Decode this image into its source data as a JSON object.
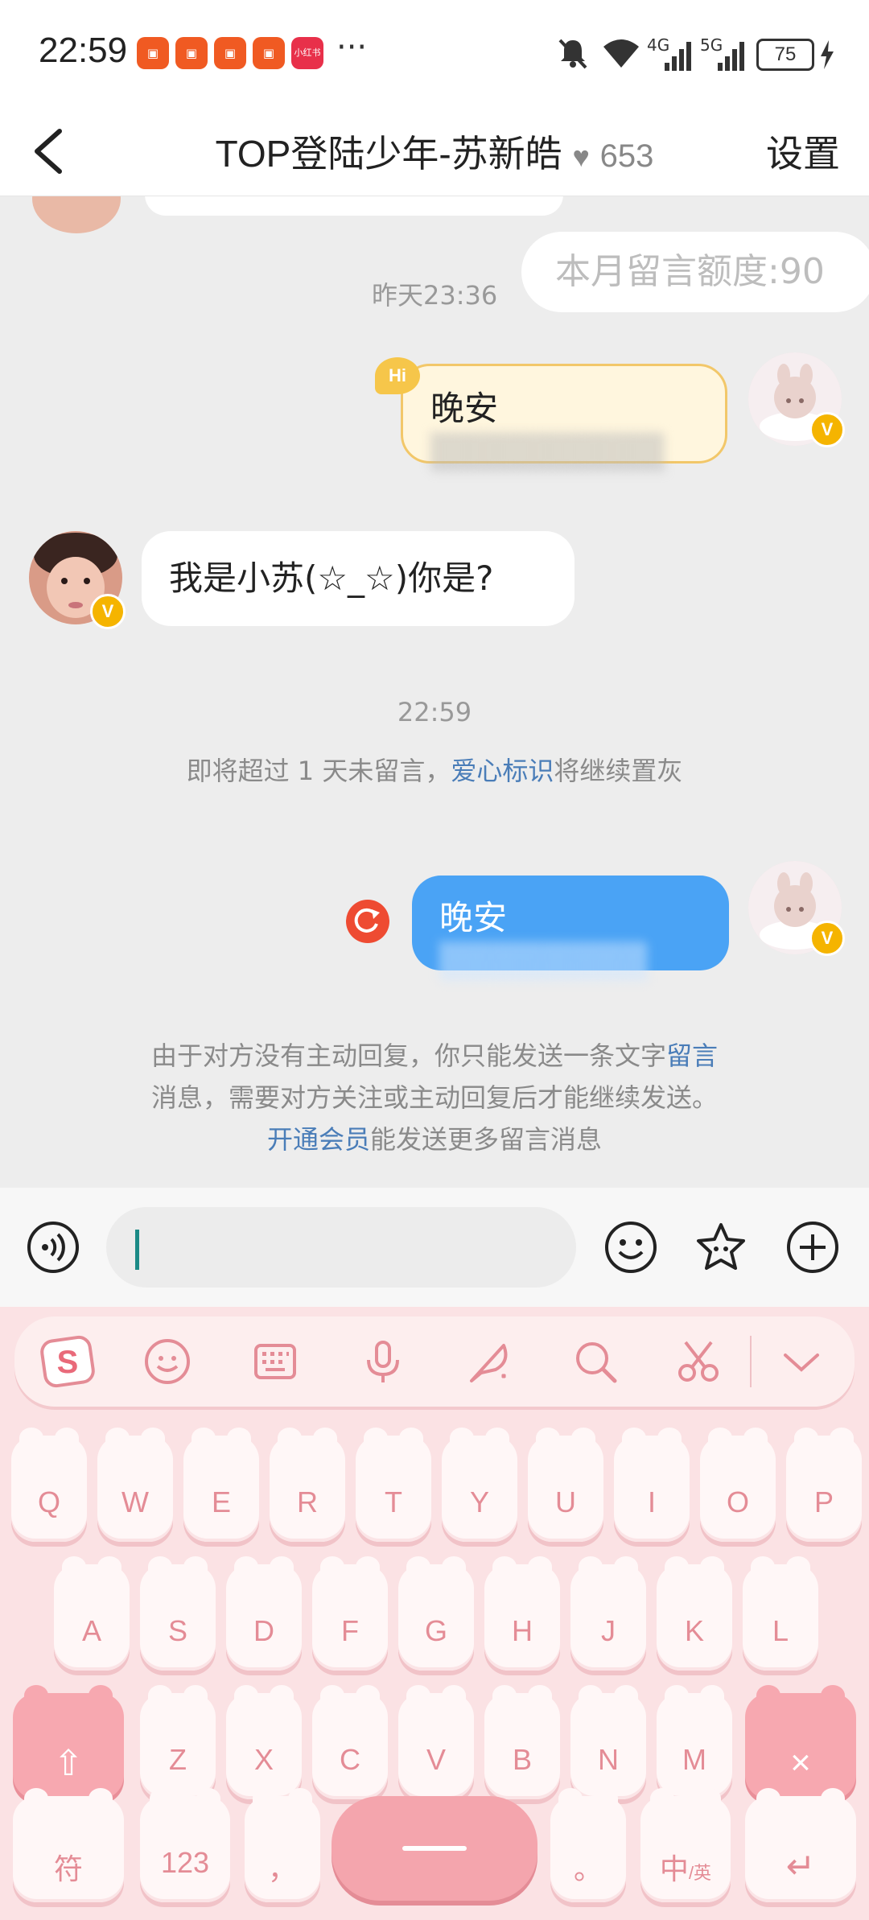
{
  "status_bar": {
    "time": "22:59",
    "app_icons": [
      "快手极速版",
      "快手",
      "快手极速版",
      "快手",
      "小红书"
    ],
    "more": "···",
    "network_4g": "4G",
    "network_5g": "5G",
    "battery": "75"
  },
  "header": {
    "title": "TOP登陆少年-苏新皓",
    "heart": "♥",
    "heart_count": "653",
    "settings_label": "设置"
  },
  "chat": {
    "timestamp_1": "昨天23:36",
    "quota_label": "本月留言额度:90",
    "msg_hi_badge": "Hi",
    "msg_1_visible": "晚安",
    "msg_1_blurred": "▒▒▒▒▒▒▒▒▒",
    "msg_2": "我是小苏(☆_☆)你是?",
    "timestamp_2": "22:59",
    "notice_1_prefix": "即将超过 1 天未留言，",
    "notice_1_link": "爱心标识",
    "notice_1_suffix": "将继续置灰",
    "msg_3_visible": "晚安",
    "msg_3_blurred": "▒▒▒▒▒▒▒▒",
    "notice_2_line1_prefix": "由于对方没有主动回复，你只能发送一条文字",
    "notice_2_line1_link": "留言",
    "notice_2_line2": "消息，需要对方关注或主动回复后才能继续发送。",
    "notice_2_line3_link": "开通会员",
    "notice_2_line3_suffix": "能发送更多留言消息",
    "verified_badge": "V"
  },
  "input_bar": {
    "placeholder": ""
  },
  "keyboard": {
    "row1": [
      "Q",
      "W",
      "E",
      "R",
      "T",
      "Y",
      "U",
      "I",
      "O",
      "P"
    ],
    "row2": [
      "A",
      "S",
      "D",
      "F",
      "G",
      "H",
      "J",
      "K",
      "L"
    ],
    "row3": [
      "Z",
      "X",
      "C",
      "V",
      "B",
      "N",
      "M"
    ],
    "symbol_key": "符",
    "num_key": "123",
    "comma_key": "，",
    "period_key": "。",
    "lang_key": "中",
    "lang_key_sub": "/英",
    "delete_key": "×",
    "enter_key": "↵",
    "shift_key": "⇧"
  },
  "colors": {
    "accent_blue": "#4aa3f5",
    "link_blue": "#4a7db8",
    "keyboard_pink": "#fbe2e4",
    "key_text": "#e48c96",
    "resend_red": "#ee4b32",
    "vip_gold": "#f5b400"
  }
}
